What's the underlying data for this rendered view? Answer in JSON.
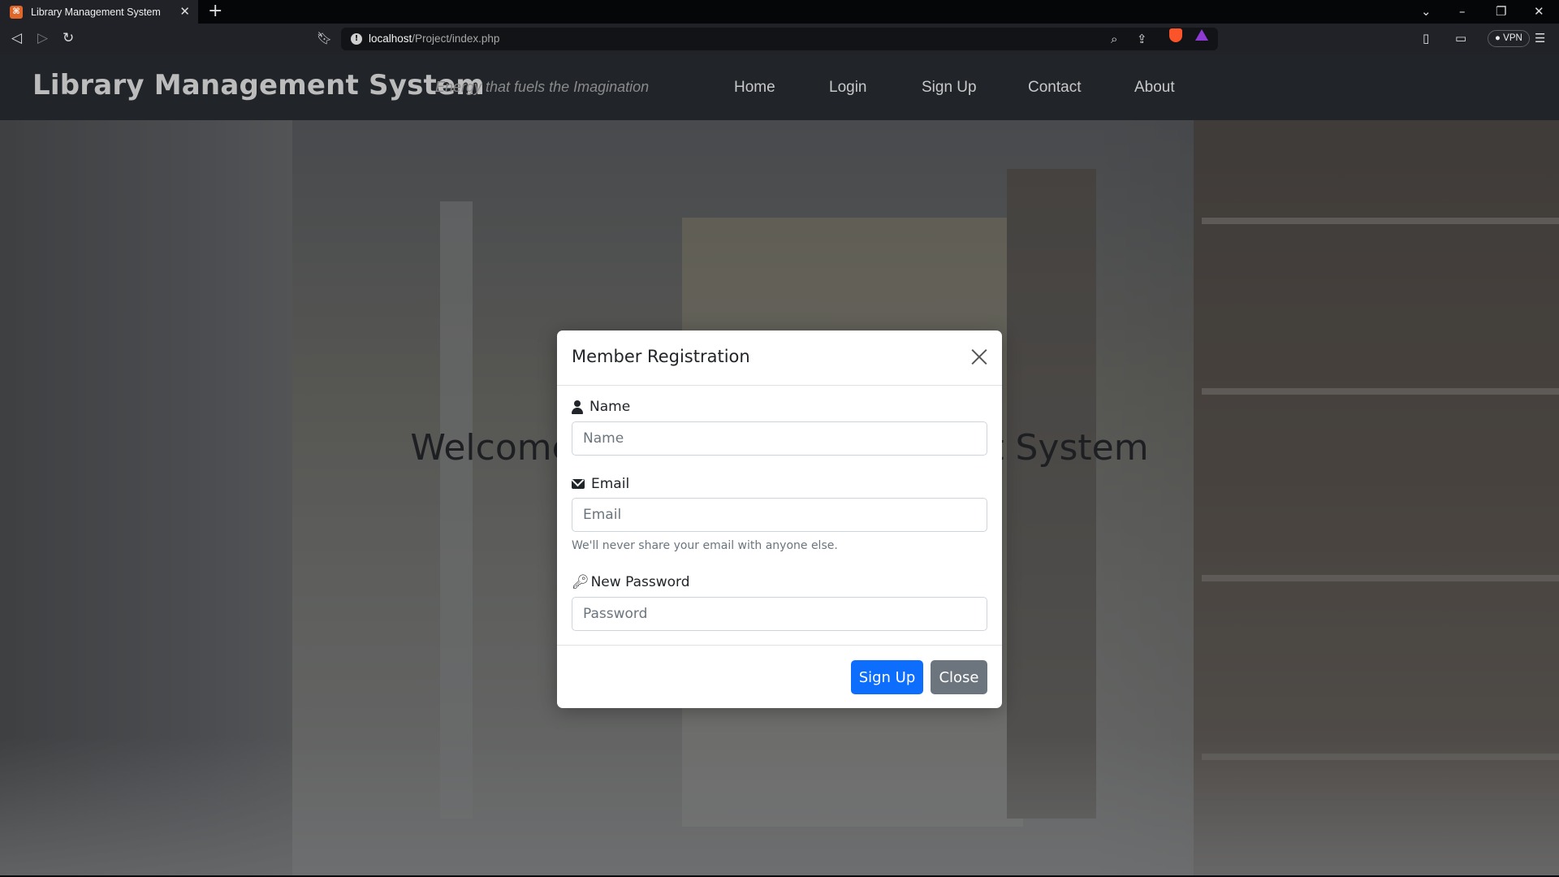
{
  "browser": {
    "tab_title": "Library Management System",
    "new_tab": "+",
    "url_host": "localhost",
    "url_path": "/Project/index.php",
    "vpn_label": "VPN"
  },
  "site": {
    "brand": "Library Management System",
    "tagline": "Energy that fuels the Imagination",
    "nav": [
      "Home",
      "Login",
      "Sign Up",
      "Contact",
      "About"
    ]
  },
  "hero": {
    "title": "Welcome to Library Management System"
  },
  "modal": {
    "title": "Member Registration",
    "name_label": "Name",
    "name_placeholder": "Name",
    "email_label": "Email",
    "email_placeholder": "Email",
    "email_help": "We'll never share your email with anyone else.",
    "password_label": "New Password",
    "password_placeholder": "Password",
    "signup_button": "Sign Up",
    "close_button": "Close"
  },
  "colors": {
    "primary": "#0d6efd",
    "secondary": "#6c757d",
    "navbar": "#212529"
  }
}
